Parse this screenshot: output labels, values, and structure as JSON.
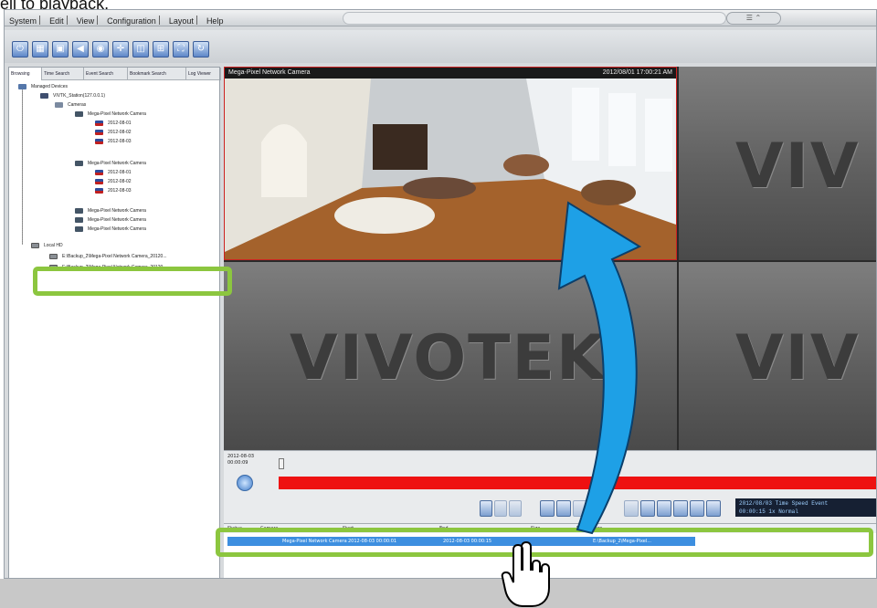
{
  "caption": "ell to playback.",
  "menu": [
    "System",
    "Edit",
    "View",
    "Configuration",
    "Layout",
    "Help"
  ],
  "tabs": [
    "Browsing",
    "Time Search",
    "Event Search",
    "Bookmark Search",
    "Log Viewer"
  ],
  "tree": {
    "managed": "Managed Devices",
    "server": "VIVTK_Station(127.0.0.1)",
    "cameras": "Cameras",
    "camera_name": "Mega-Pixel Network Camera",
    "dates": [
      "2012-08-01",
      "2012-08-02",
      "2012-08-03"
    ],
    "local": "Local HD",
    "file1": "E:\\Backup_2\\Mega-Pixel Network Camera_20120...",
    "file2": "E:\\Backup_2\\Mega-Pixel Network Camera_20120..."
  },
  "video": {
    "cam_label": "Mega-Pixel Network Camera",
    "timestamp": "2012/08/01 17:00:21 AM",
    "watermark": "VIVOTEK",
    "watermark_partial": "VIV"
  },
  "playback": {
    "start_date": "2012-08-03",
    "start_time": "00:00:09",
    "display_line1": "2012/08/03 Time Speed Event",
    "display_line2": "00:00:15    1x    Normal"
  },
  "list": {
    "headers": [
      "Status",
      "Camera",
      "Start",
      "End",
      "Size",
      "Description"
    ],
    "row": [
      "",
      "Mega-Pixel Network Camera",
      "2012-08-03 00:00:01",
      "2012-08-03 00:00:15",
      "",
      "E:\\Backup_2\\Mega-Pixel..."
    ]
  },
  "colors": {
    "highlight": "#8cc63f",
    "arrow": "#1ea0e6",
    "timeline": "#ee1111",
    "selection": "#3d8fe0"
  }
}
